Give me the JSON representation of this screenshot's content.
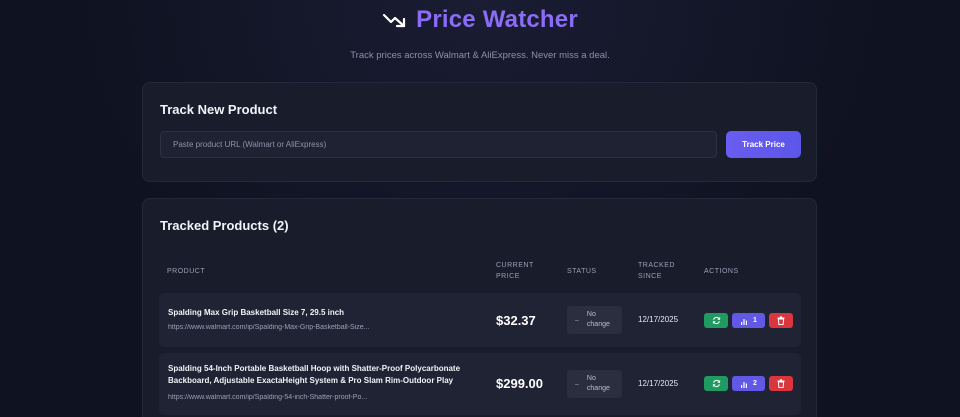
{
  "header": {
    "title": "Price Watcher",
    "subtitle": "Track prices across Walmart & AliExpress. Never miss a deal.",
    "icon": "trending-down-icon",
    "accent": "#8b6cf6"
  },
  "track": {
    "title": "Track New Product",
    "placeholder": "Paste product URL (Walmart or AliExpress)",
    "button_label": "Track Price"
  },
  "list": {
    "title": "Tracked Products (2)",
    "columns": {
      "product": "PRODUCT",
      "current_price": "CURRENT\nPRICE",
      "status": "STATUS",
      "tracked_since": "TRACKED\nSINCE",
      "actions": "ACTIONS"
    },
    "rows": [
      {
        "name": "Spalding Max Grip Basketball Size 7, 29.5 inch",
        "url": "https://www.walmart.com/ip/Spalding-Max-Grip-Basketball-Size...",
        "price": "$32.37",
        "status_dash": "–",
        "status": "No\nchange",
        "tracked_since": "12/17/2025",
        "history_count": "1"
      },
      {
        "name": "Spalding 54-Inch Portable Basketball Hoop with Shatter-Proof Polycarbonate Backboard, Adjustable ExactaHeight System & Pro Slam Rim-Outdoor Play",
        "url": "https://www.walmart.com/ip/Spalding-54-inch-Shatter-proof-Po...",
        "price": "$299.00",
        "status_dash": "–",
        "status": "No\nchange",
        "tracked_since": "12/17/2025",
        "history_count": "2"
      }
    ]
  },
  "colors": {
    "refresh": "#1f9a61",
    "history": "#6159e6",
    "delete": "#d9363e",
    "primary_button": "#6a5cf0"
  }
}
